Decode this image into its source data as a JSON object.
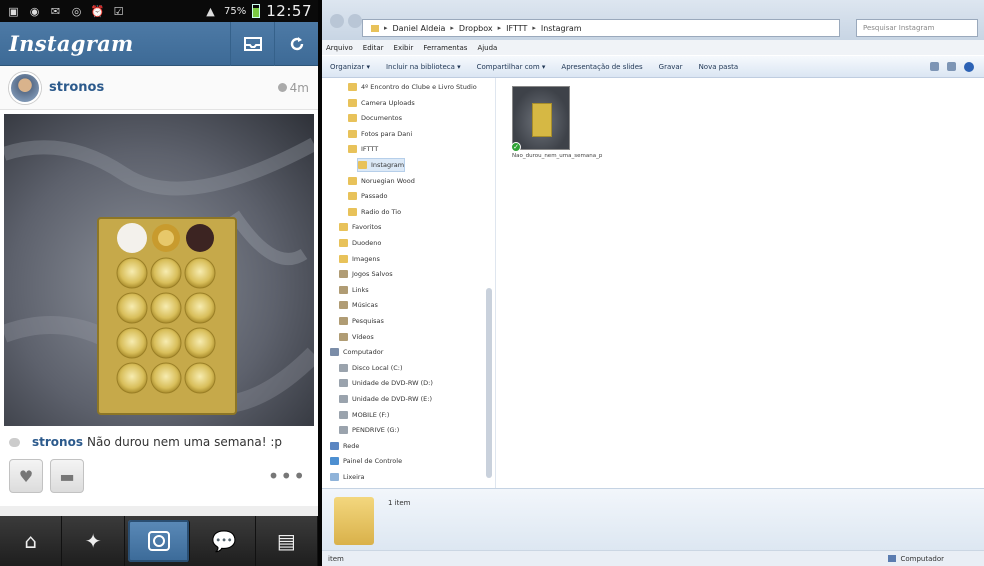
{
  "phone": {
    "status_bar": {
      "battery": "75%",
      "time": "12:57",
      "left_icons": [
        "image-icon",
        "whatsapp-icon",
        "gmail-icon",
        "voicemail-icon",
        "alarm-icon",
        "task-icon"
      ]
    },
    "app_title": "Instagram",
    "post": {
      "username": "stronos",
      "time_ago": "4m",
      "caption_user": "stronos",
      "caption_text": "Não durou nem uma semana! :p",
      "more_label": "•••"
    },
    "tabs": [
      "home-icon",
      "explore-icon",
      "camera-icon",
      "news-icon",
      "profile-icon"
    ],
    "active_tab_index": 2,
    "accent_color": "#3d6a96"
  },
  "explorer": {
    "address": {
      "crumbs": [
        "Daniel Aldeia",
        "Dropbox",
        "IFTTT",
        "Instagram"
      ]
    },
    "search_placeholder": "Pesquisar Instagram",
    "menu": [
      "Arquivo",
      "Editar",
      "Exibir",
      "Ferramentas",
      "Ajuda"
    ],
    "toolbar": [
      "Organizar ▾",
      "Incluir na biblioteca ▾",
      "Compartilhar com ▾",
      "Apresentação de slides",
      "Gravar",
      "Nova pasta"
    ],
    "nav_items": [
      {
        "label": "4º Encontro do Clube e Livro Studio",
        "icon": "folder",
        "indent": 2
      },
      {
        "label": "Camera Uploads",
        "icon": "folder",
        "indent": 2
      },
      {
        "label": "Documentos",
        "icon": "folder",
        "indent": 2
      },
      {
        "label": "Fotos para Dani",
        "icon": "folder",
        "indent": 2
      },
      {
        "label": "IFTTT",
        "icon": "folder",
        "indent": 2
      },
      {
        "label": "Instagram",
        "icon": "folder",
        "indent": 3,
        "selected": true
      },
      {
        "label": "Noruegian Wood",
        "icon": "folder",
        "indent": 2
      },
      {
        "label": "Passado",
        "icon": "folder",
        "indent": 2
      },
      {
        "label": "Radio do Tio",
        "icon": "folder",
        "indent": 2
      },
      {
        "label": "Favoritos",
        "icon": "folder",
        "indent": 1
      },
      {
        "label": "Duodeno",
        "icon": "folder",
        "indent": 1
      },
      {
        "label": "Imagens",
        "icon": "folder",
        "indent": 1
      },
      {
        "label": "Jogos Salvos",
        "icon": "lib",
        "indent": 1
      },
      {
        "label": "Links",
        "icon": "lib",
        "indent": 1
      },
      {
        "label": "Músicas",
        "icon": "lib",
        "indent": 1
      },
      {
        "label": "Pesquisas",
        "icon": "lib",
        "indent": 1
      },
      {
        "label": "Vídeos",
        "icon": "lib",
        "indent": 1
      },
      {
        "label": "Computador",
        "icon": "comp",
        "indent": 0
      },
      {
        "label": "Disco Local (C:)",
        "icon": "drive",
        "indent": 1
      },
      {
        "label": "Unidade de DVD-RW (D:)",
        "icon": "drive",
        "indent": 1
      },
      {
        "label": "Unidade de DVD-RW (E:)",
        "icon": "drive",
        "indent": 1
      },
      {
        "label": "MOBILE (F:)",
        "icon": "drive",
        "indent": 1
      },
      {
        "label": "PENDRIVE (G:)",
        "icon": "drive",
        "indent": 1
      },
      {
        "label": "Rede",
        "icon": "net",
        "indent": 0
      },
      {
        "label": "Painel de Controle",
        "icon": "cp",
        "indent": 0
      },
      {
        "label": "Lixeira",
        "icon": "trash",
        "indent": 0
      }
    ],
    "file": {
      "name": "Nao_durou_nem_uma_semana_p"
    },
    "details_count": "1 item",
    "status_left": "item",
    "status_right": "Computador"
  }
}
